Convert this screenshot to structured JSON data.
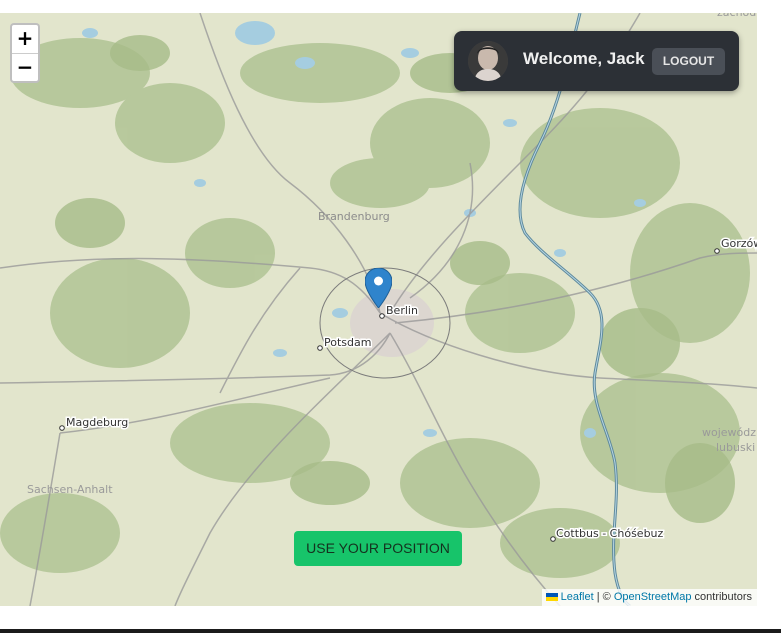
{
  "zoom": {
    "in_label": "+",
    "out_label": "−"
  },
  "user": {
    "welcome": "Welcome, Jack",
    "logout_label": "LOGOUT"
  },
  "actions": {
    "use_position_label": "USE YOUR POSITION"
  },
  "map": {
    "places": {
      "brandenburg": "Brandenburg",
      "berlin": "Berlin",
      "potsdam": "Potsdam",
      "magdeburg": "Magdeburg",
      "sachsen_anhalt": "Sachsen-Anhalt",
      "gorzow": "Gorzów",
      "cottbus": "Cottbus - Chóśebuz",
      "wojewodztwo_line1": "wojewódz",
      "wojewodztwo_line2": "lubuski",
      "zachod": "zachod"
    },
    "marker": "Berlin",
    "colors": {
      "forest": "#b3c698",
      "water": "#a5cde0",
      "roads": "#8f8f8f",
      "border": "#5a7f8d"
    }
  },
  "attribution": {
    "leaflet": "Leaflet",
    "separator": " | © ",
    "osm": "OpenStreetMap",
    "contributors": " contributors"
  }
}
